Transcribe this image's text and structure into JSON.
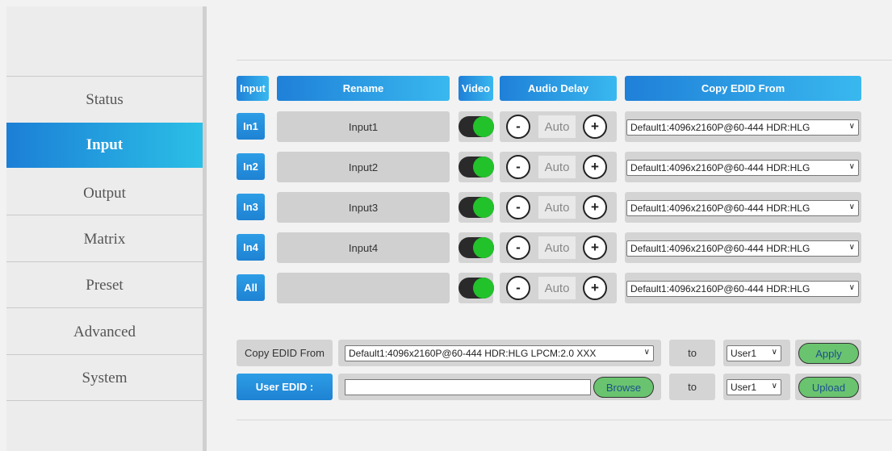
{
  "sidebar": {
    "items": [
      {
        "label": "Status"
      },
      {
        "label": "Input",
        "active": true
      },
      {
        "label": "Output"
      },
      {
        "label": "Matrix"
      },
      {
        "label": "Preset"
      },
      {
        "label": "Advanced"
      },
      {
        "label": "System"
      }
    ]
  },
  "table": {
    "headers": {
      "input": "Input",
      "rename": "Rename",
      "video": "Video",
      "audio_delay": "Audio Delay",
      "copy_edid": "Copy EDID From"
    },
    "rows": [
      {
        "input": "In1",
        "name": "Input1",
        "video_on": true,
        "delay": "Auto",
        "edid": "Default1:4096x2160P@60-444 HDR:HLG"
      },
      {
        "input": "In2",
        "name": "Input2",
        "video_on": true,
        "delay": "Auto",
        "edid": "Default1:4096x2160P@60-444 HDR:HLG"
      },
      {
        "input": "In3",
        "name": "Input3",
        "video_on": true,
        "delay": "Auto",
        "edid": "Default1:4096x2160P@60-444 HDR:HLG"
      },
      {
        "input": "In4",
        "name": "Input4",
        "video_on": true,
        "delay": "Auto",
        "edid": "Default1:4096x2160P@60-444 HDR:HLG"
      },
      {
        "input": "All",
        "name": "",
        "video_on": true,
        "delay": "Auto",
        "edid": "Default1:4096x2160P@60-444 HDR:HLG"
      }
    ],
    "minus_symbol": "-",
    "plus_symbol": "+"
  },
  "copy_edid": {
    "label": "Copy EDID From",
    "source": "Default1:4096x2160P@60-444 HDR:HLG LPCM:2.0 XXX",
    "to_label": "to",
    "target": "User1",
    "apply_label": "Apply"
  },
  "user_edid": {
    "label": "User EDID :",
    "file_value": "",
    "browse_label": "Browse",
    "to_label": "to",
    "target": "User1",
    "upload_label": "Upload"
  },
  "colors": {
    "accent": "#1f80d8",
    "toggle_on": "#22c22a",
    "button_green": "#6ac46f"
  }
}
